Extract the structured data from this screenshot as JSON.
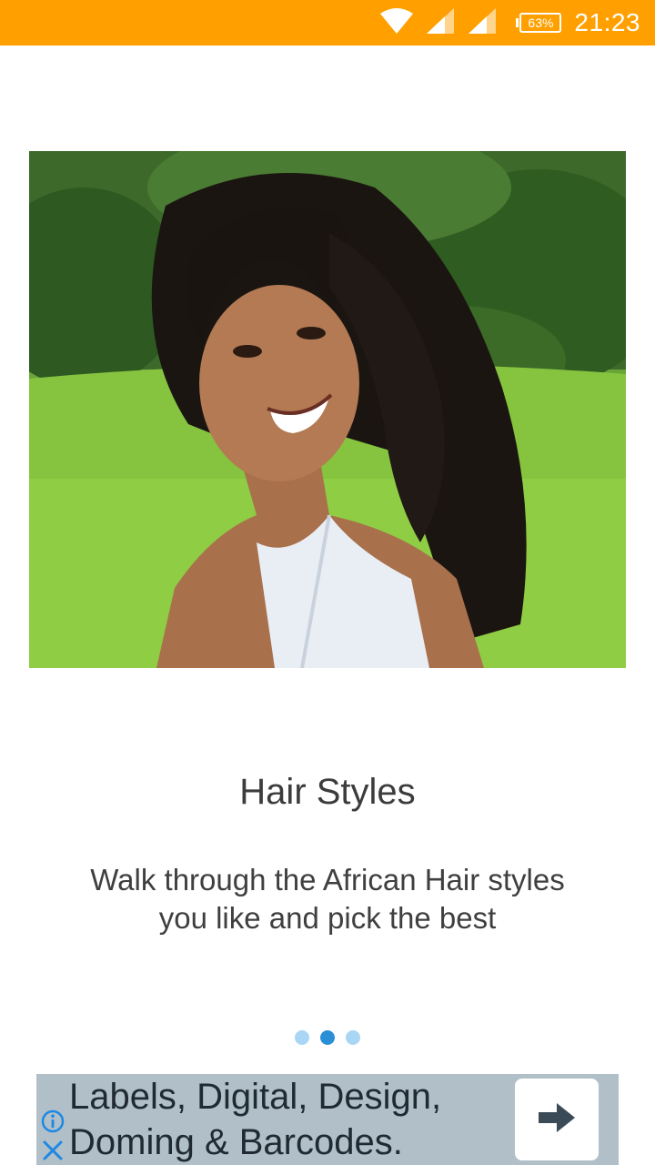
{
  "status_bar": {
    "battery": "63%",
    "time": "21:23",
    "icons": [
      "wifi-icon",
      "signal-icon",
      "signal-icon",
      "battery-icon"
    ]
  },
  "hero": {
    "icon": "hairstyle-photo"
  },
  "content": {
    "title": "Hair Styles",
    "description_line1": "Walk through the African Hair styles",
    "description_line2": "you like and pick the best"
  },
  "pager": {
    "total": 3,
    "active_index": 1
  },
  "ad": {
    "line1": "Labels, Digital, Design,",
    "line2": "Doming & Barcodes.",
    "button_icon": "arrow-right-icon",
    "colors": {
      "background": "#b1c0c8",
      "accent": "#1e88e5"
    }
  }
}
